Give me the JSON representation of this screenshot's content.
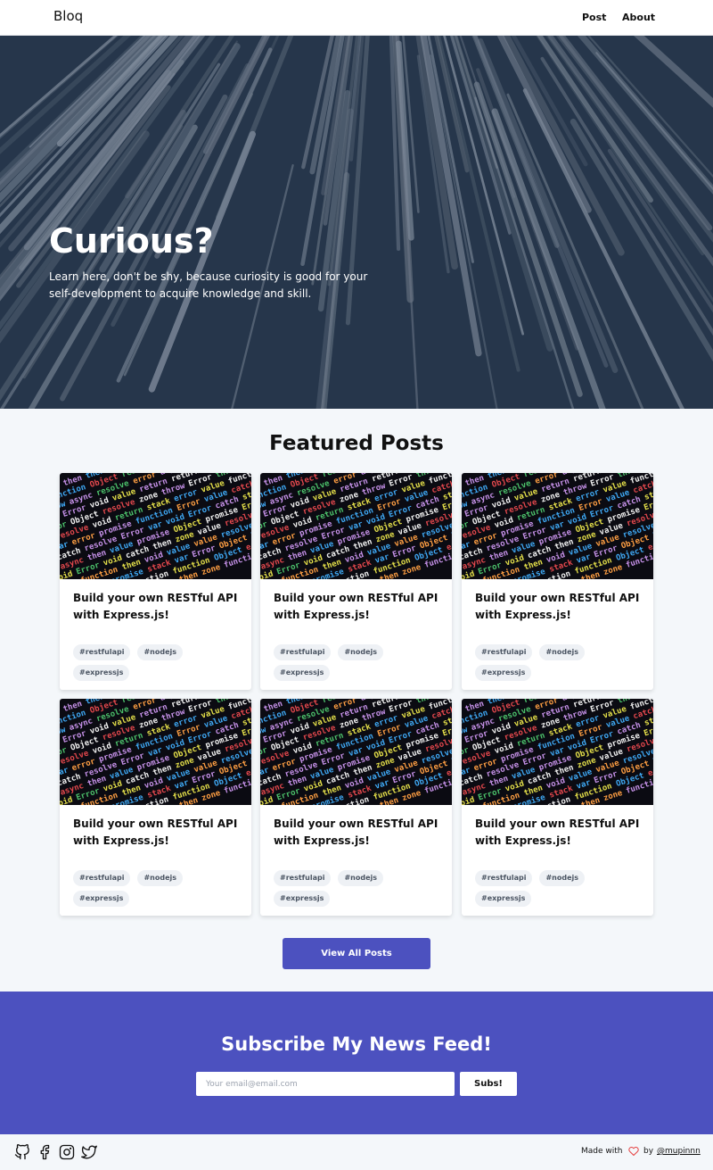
{
  "navbar": {
    "brand": "Bloq",
    "links": [
      "Post",
      "About"
    ]
  },
  "hero": {
    "title": "Curious?",
    "subtitle": "Learn here, don't be shy, because curiosity is good for your self-development to acquire knowledge and skill."
  },
  "featured": {
    "title": "Featured Posts",
    "posts": [
      {
        "title": "Build your own RESTful API with Express.js!",
        "tags": [
          "#restfulapi",
          "#nodejs",
          "#expressjs"
        ]
      },
      {
        "title": "Build your own RESTful API with Express.js!",
        "tags": [
          "#restfulapi",
          "#nodejs",
          "#expressjs"
        ]
      },
      {
        "title": "Build your own RESTful API with Express.js!",
        "tags": [
          "#restfulapi",
          "#nodejs",
          "#expressjs"
        ]
      },
      {
        "title": "Build your own RESTful API with Express.js!",
        "tags": [
          "#restfulapi",
          "#nodejs",
          "#expressjs"
        ]
      },
      {
        "title": "Build your own RESTful API with Express.js!",
        "tags": [
          "#restfulapi",
          "#nodejs",
          "#expressjs"
        ]
      },
      {
        "title": "Build your own RESTful API with Express.js!",
        "tags": [
          "#restfulapi",
          "#nodejs",
          "#expressjs"
        ]
      }
    ],
    "view_all_label": "View All Posts"
  },
  "subscribe": {
    "title": "Subscribe My News Feed!",
    "email_placeholder": "Your email@email.com",
    "button_label": "Subs!"
  },
  "footer": {
    "social_icons": [
      "github-icon",
      "facebook-icon",
      "instagram-icon",
      "twitter-icon"
    ],
    "made_with": "Made with",
    "by": "by",
    "handle": "@mupinnn"
  },
  "colors": {
    "accent": "#4c51bf",
    "hero_bg": "#2a3c52",
    "heart": "#e53e3e"
  }
}
